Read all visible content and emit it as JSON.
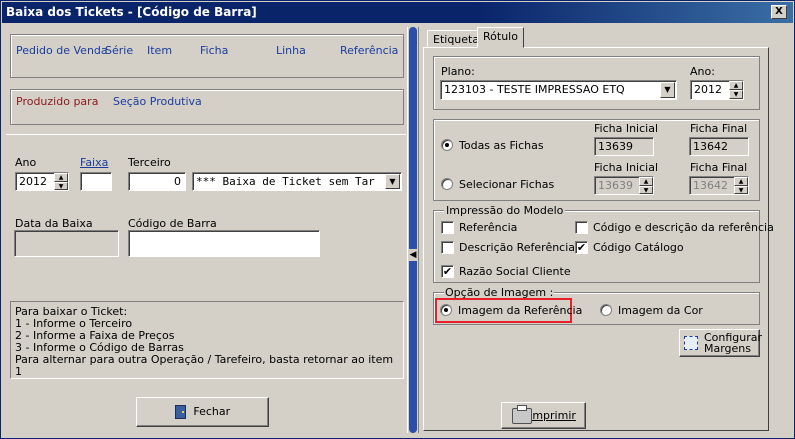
{
  "window": {
    "title": "Baixa dos Tickets - [Código de Barra]",
    "close_glyph": "X"
  },
  "header_columns": [
    "Pedido de Venda",
    "Série",
    "Item",
    "Ficha",
    "Linha",
    "Referência"
  ],
  "production": {
    "produced_for": "Produzido para",
    "section": "Seção Produtiva"
  },
  "form": {
    "ano_label": "Ano",
    "ano_value": "2012",
    "faixa_label": "Faixa",
    "faixa_value": "",
    "terceiro_label": "Terceiro",
    "terceiro_value": "0",
    "terceiro_combo": "*** Baixa de Ticket sem Tar",
    "data_baixa_label": "Data da Baixa",
    "codigo_barra_label": "Código de Barra",
    "codigo_barra_value": ""
  },
  "instructions": [
    "Para baixar o Ticket:",
    "1 - Informe o Terceiro",
    "2 - Informe a Faixa de Preços",
    "3 - Informe o Código de Barras",
    "Para alternar para outra Operação / Tarefeiro, basta retornar ao item 1"
  ],
  "buttons": {
    "fechar": "Fechar",
    "imprimir": "Imprimir",
    "configurar": "Configurar Margens"
  },
  "splitter_glyph": "◀",
  "tabs": [
    "Etiqueta",
    "Rótulo"
  ],
  "plano": {
    "label": "Plano:",
    "value": "123103 - TESTE IMPRESSAO ETQ",
    "ano_label": "Ano:",
    "ano_value": "2012"
  },
  "fichas": {
    "todas": "Todas as Fichas",
    "selecionar": "Selecionar Fichas",
    "ficha_inicial": "Ficha Inicial",
    "ficha_final": "Ficha Final",
    "todas_inicial": "13639",
    "todas_final": "13642",
    "sel_inicial": "13639",
    "sel_final": "13642"
  },
  "impressao": {
    "title": "Impressão do Modelo",
    "referencia": "Referência",
    "codigo_desc": "Código e descrição da referência",
    "desc_ref": "Descrição Referência",
    "codigo_catalogo": "Código Catálogo",
    "razao_social": "Razão Social Cliente",
    "check_glyph": "✔"
  },
  "imagem": {
    "title": "Opção de Imagem :",
    "referencia": "Imagem da Referência",
    "cor": "Imagem da Cor"
  },
  "colors": {
    "highlight": "#e8202a",
    "titlebar": "#0a246a"
  }
}
